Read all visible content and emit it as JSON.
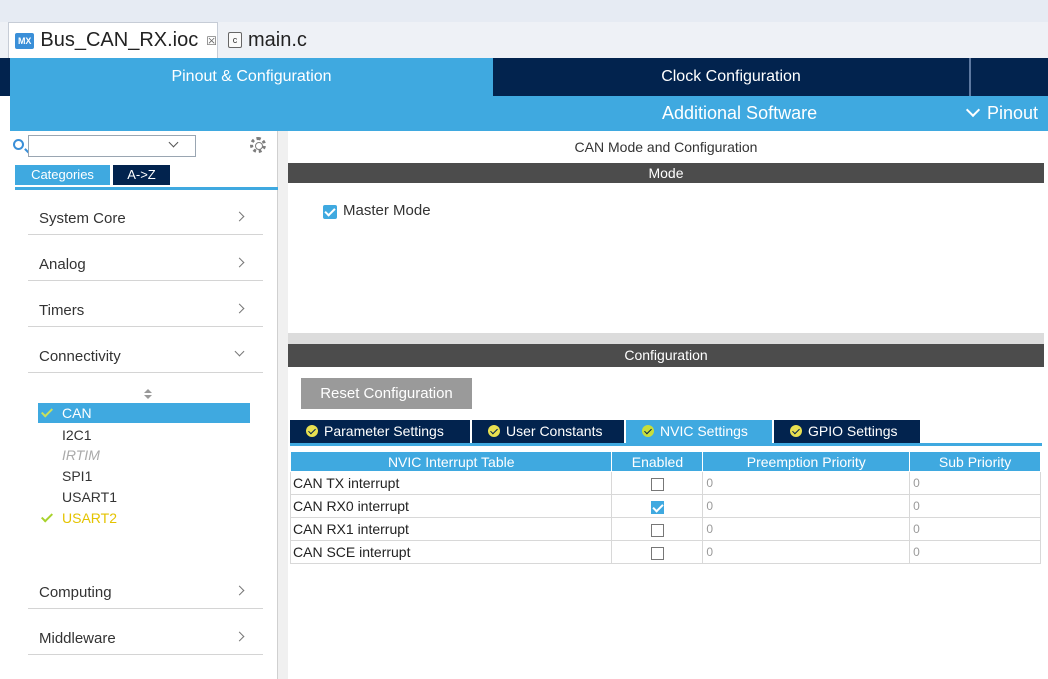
{
  "editor_tabs": {
    "ioc": {
      "icon": "MX",
      "label": "Bus_CAN_RX.ioc",
      "close": "☒"
    },
    "main": {
      "icon": "c",
      "label": "main.c"
    }
  },
  "perspective_tabs": {
    "pinout_config": "Pinout & Configuration",
    "clock_config": "Clock Configuration",
    "additional_software": "Additional Software",
    "pinout_menu": "Pinout"
  },
  "left_panel": {
    "search": {
      "value": "",
      "placeholder": ""
    },
    "categories_label": "Categories",
    "az_label": "A->Z",
    "categories": [
      {
        "label": "System Core"
      },
      {
        "label": "Analog"
      },
      {
        "label": "Timers"
      },
      {
        "label": "Connectivity"
      },
      {
        "label": "Computing"
      },
      {
        "label": "Middleware"
      }
    ],
    "connectivity_items": [
      {
        "label": "CAN",
        "state": "enabled-selected"
      },
      {
        "label": "I2C1",
        "state": "normal"
      },
      {
        "label": "IRTIM",
        "state": "disabled"
      },
      {
        "label": "SPI1",
        "state": "normal"
      },
      {
        "label": "USART1",
        "state": "normal"
      },
      {
        "label": "USART2",
        "state": "enabled"
      }
    ]
  },
  "main": {
    "title": "CAN Mode and Configuration",
    "mode_header": "Mode",
    "master_mode": {
      "label": "Master Mode",
      "checked": true
    },
    "configuration_header": "Configuration",
    "reset_button": "Reset Configuration",
    "config_tabs": [
      {
        "label": "Parameter Settings"
      },
      {
        "label": "User Constants"
      },
      {
        "label": "NVIC Settings",
        "active": true
      },
      {
        "label": "GPIO Settings"
      }
    ],
    "nvic_table": {
      "headers": [
        "NVIC Interrupt Table",
        "Enabled",
        "Preemption Priority",
        "Sub Priority"
      ],
      "rows": [
        {
          "name": "CAN TX interrupt",
          "enabled": false,
          "preemption": "0",
          "sub": "0"
        },
        {
          "name": "CAN RX0 interrupt",
          "enabled": true,
          "preemption": "0",
          "sub": "0"
        },
        {
          "name": "CAN RX1 interrupt",
          "enabled": false,
          "preemption": "0",
          "sub": "0"
        },
        {
          "name": "CAN SCE interrupt",
          "enabled": false,
          "preemption": "0",
          "sub": "0"
        }
      ]
    }
  },
  "colors": {
    "accent": "#3fa9e0",
    "navy": "#02234e",
    "dark_header": "#4c4c4c",
    "enabled_check": "#a8d22c",
    "enabled_text": "#e4c300"
  }
}
